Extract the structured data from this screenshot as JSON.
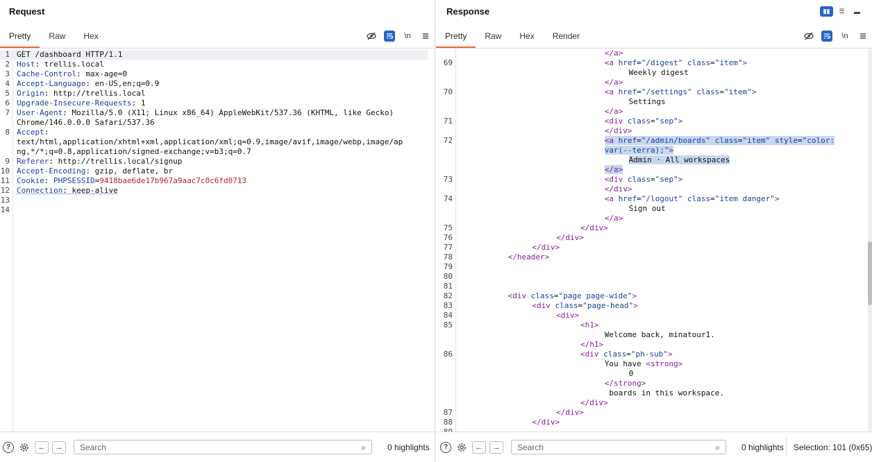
{
  "request": {
    "title": "Request",
    "tabs": [
      "Pretty",
      "Raw",
      "Hex"
    ],
    "lines": [
      {
        "n": "1",
        "parts": [
          [
            "v",
            "GET /dashboard HTTP/1.1"
          ]
        ]
      },
      {
        "n": "2",
        "parts": [
          [
            "k",
            "Host"
          ],
          [
            "v",
            ": trellis.local"
          ]
        ]
      },
      {
        "n": "3",
        "parts": [
          [
            "k",
            "Cache-Control"
          ],
          [
            "v",
            ": max-age=0"
          ]
        ]
      },
      {
        "n": "4",
        "parts": [
          [
            "k",
            "Accept-Language"
          ],
          [
            "v",
            ": en-US,en;q=0.9"
          ]
        ]
      },
      {
        "n": "5",
        "parts": [
          [
            "k",
            "Origin"
          ],
          [
            "v",
            ": http://trellis.local"
          ]
        ]
      },
      {
        "n": "6",
        "parts": [
          [
            "k",
            "Upgrade-Insecure-Requests"
          ],
          [
            "v",
            ": 1"
          ]
        ]
      },
      {
        "n": "7",
        "parts": [
          [
            "k",
            "User-Agent"
          ],
          [
            "v",
            ": Mozilla/5.0 (X11; Linux x86_64) AppleWebKit/537.36 (KHTML, like Gecko)"
          ]
        ]
      },
      {
        "n": "",
        "parts": [
          [
            "v",
            "Chrome/146.0.0.0 Safari/537.36"
          ]
        ]
      },
      {
        "n": "8",
        "parts": [
          [
            "k",
            "Accept"
          ],
          [
            "v",
            ":"
          ]
        ]
      },
      {
        "n": "",
        "parts": [
          [
            "v",
            "text/html,application/xhtml+xml,application/xml;q=0.9,image/avif,image/webp,image/ap"
          ]
        ]
      },
      {
        "n": "",
        "parts": [
          [
            "v",
            "ng,*/*;q=0.8,application/signed-exchange;v=b3;q=0.7"
          ]
        ]
      },
      {
        "n": "9",
        "parts": [
          [
            "k",
            "Referer"
          ],
          [
            "v",
            ": http://trellis.local/signup"
          ]
        ]
      },
      {
        "n": "10",
        "parts": [
          [
            "k",
            "Accept-Encoding"
          ],
          [
            "v",
            ": gzip, deflate, br"
          ]
        ]
      },
      {
        "n": "11",
        "parts": [
          [
            "k",
            "Cookie"
          ],
          [
            "v",
            ": "
          ],
          [
            "k",
            "PHPSESSID"
          ],
          [
            "v",
            "="
          ],
          [
            "cookie",
            "9418bae6de17b967a9aac7c0c6fd0713"
          ]
        ]
      },
      {
        "n": "12",
        "parts": [
          [
            "k",
            "Connection"
          ],
          [
            "v",
            ": keep-alive"
          ]
        ]
      },
      {
        "n": "13",
        "parts": []
      },
      {
        "n": "14",
        "parts": []
      }
    ],
    "search_placeholder": "Search",
    "highlights": "0 highlights"
  },
  "response": {
    "title": "Response",
    "tabs": [
      "Pretty",
      "Raw",
      "Hex",
      "Render"
    ],
    "lines": [
      {
        "n": "",
        "i": 6,
        "parts": [
          [
            "tag",
            "</a>"
          ]
        ]
      },
      {
        "n": "69",
        "i": 6,
        "parts": [
          [
            "tag",
            "<a "
          ],
          [
            "attr",
            "href"
          ],
          [
            "v",
            "="
          ],
          [
            "str",
            "\"/digest\""
          ],
          [
            "v",
            " "
          ],
          [
            "attr",
            "class"
          ],
          [
            "v",
            "="
          ],
          [
            "str",
            "\"item\""
          ],
          [
            "tag",
            ">"
          ]
        ]
      },
      {
        "n": "",
        "i": 7,
        "parts": [
          [
            "v",
            "Weekly digest"
          ]
        ]
      },
      {
        "n": "",
        "i": 6,
        "parts": [
          [
            "tag",
            "</a>"
          ]
        ]
      },
      {
        "n": "70",
        "i": 6,
        "parts": [
          [
            "tag",
            "<a "
          ],
          [
            "attr",
            "href"
          ],
          [
            "v",
            "="
          ],
          [
            "str",
            "\"/settings\""
          ],
          [
            "v",
            " "
          ],
          [
            "attr",
            "class"
          ],
          [
            "v",
            "="
          ],
          [
            "str",
            "\"item\""
          ],
          [
            "tag",
            ">"
          ]
        ]
      },
      {
        "n": "",
        "i": 7,
        "parts": [
          [
            "v",
            "Settings"
          ]
        ]
      },
      {
        "n": "",
        "i": 6,
        "parts": [
          [
            "tag",
            "</a>"
          ]
        ]
      },
      {
        "n": "71",
        "i": 6,
        "parts": [
          [
            "tag",
            "<div "
          ],
          [
            "attr",
            "class"
          ],
          [
            "v",
            "="
          ],
          [
            "str",
            "\"sep\""
          ],
          [
            "tag",
            ">"
          ]
        ]
      },
      {
        "n": "",
        "i": 6,
        "parts": [
          [
            "tag",
            "</div>"
          ]
        ]
      },
      {
        "n": "72",
        "i": 6,
        "sel": true,
        "parts": [
          [
            "tag",
            "<a "
          ],
          [
            "attr",
            "href"
          ],
          [
            "v",
            "="
          ],
          [
            "str",
            "\"/admin/boards\""
          ],
          [
            "v",
            " "
          ],
          [
            "attr",
            "class"
          ],
          [
            "v",
            "="
          ],
          [
            "str",
            "\"item\""
          ],
          [
            "v",
            " "
          ],
          [
            "attr",
            "style"
          ],
          [
            "v",
            "="
          ],
          [
            "str",
            "\"color:"
          ]
        ]
      },
      {
        "n": "",
        "i": 6,
        "sel": true,
        "parts": [
          [
            "str",
            "var(--terra);\""
          ],
          [
            "tag",
            ">"
          ]
        ]
      },
      {
        "n": "",
        "i": 7,
        "sel": true,
        "parts": [
          [
            "v",
            "Admin · All workspaces"
          ]
        ]
      },
      {
        "n": "",
        "i": 6,
        "sel": true,
        "parts": [
          [
            "tag",
            "</a>"
          ]
        ]
      },
      {
        "n": "73",
        "i": 6,
        "parts": [
          [
            "tag",
            "<div "
          ],
          [
            "attr",
            "class"
          ],
          [
            "v",
            "="
          ],
          [
            "str",
            "\"sep\""
          ],
          [
            "tag",
            ">"
          ]
        ]
      },
      {
        "n": "",
        "i": 6,
        "parts": [
          [
            "tag",
            "</div>"
          ]
        ]
      },
      {
        "n": "74",
        "i": 6,
        "parts": [
          [
            "tag",
            "<a "
          ],
          [
            "attr",
            "href"
          ],
          [
            "v",
            "="
          ],
          [
            "str",
            "\"/logout\""
          ],
          [
            "v",
            " "
          ],
          [
            "attr",
            "class"
          ],
          [
            "v",
            "="
          ],
          [
            "str",
            "\"item danger\""
          ],
          [
            "tag",
            ">"
          ]
        ]
      },
      {
        "n": "",
        "i": 7,
        "parts": [
          [
            "v",
            "Sign out"
          ]
        ]
      },
      {
        "n": "",
        "i": 6,
        "parts": [
          [
            "tag",
            "</a>"
          ]
        ]
      },
      {
        "n": "75",
        "i": 5,
        "parts": [
          [
            "tag",
            "</div>"
          ]
        ]
      },
      {
        "n": "76",
        "i": 4,
        "parts": [
          [
            "tag",
            "</div>"
          ]
        ]
      },
      {
        "n": "77",
        "i": 3,
        "parts": [
          [
            "tag",
            "</div>"
          ]
        ]
      },
      {
        "n": "78",
        "i": 2,
        "parts": [
          [
            "tag",
            "</header>"
          ]
        ]
      },
      {
        "n": "79",
        "i": 0,
        "parts": []
      },
      {
        "n": "80",
        "i": 0,
        "parts": []
      },
      {
        "n": "81",
        "i": 0,
        "parts": []
      },
      {
        "n": "82",
        "i": 2,
        "parts": [
          [
            "tag",
            "<div "
          ],
          [
            "attr",
            "class"
          ],
          [
            "v",
            "="
          ],
          [
            "str",
            "\"page page-wide\""
          ],
          [
            "tag",
            ">"
          ]
        ]
      },
      {
        "n": "83",
        "i": 3,
        "parts": [
          [
            "tag",
            "<div "
          ],
          [
            "attr",
            "class"
          ],
          [
            "v",
            "="
          ],
          [
            "str",
            "\"page-head\""
          ],
          [
            "tag",
            ">"
          ]
        ]
      },
      {
        "n": "84",
        "i": 4,
        "parts": [
          [
            "tag",
            "<div>"
          ]
        ]
      },
      {
        "n": "85",
        "i": 5,
        "parts": [
          [
            "tag",
            "<h1>"
          ]
        ]
      },
      {
        "n": "",
        "i": 6,
        "parts": [
          [
            "v",
            "Welcome back, minatour1."
          ]
        ]
      },
      {
        "n": "",
        "i": 5,
        "parts": [
          [
            "tag",
            "</h1>"
          ]
        ]
      },
      {
        "n": "86",
        "i": 5,
        "parts": [
          [
            "tag",
            "<div "
          ],
          [
            "attr",
            "class"
          ],
          [
            "v",
            "="
          ],
          [
            "str",
            "\"ph-sub\""
          ],
          [
            "tag",
            ">"
          ]
        ]
      },
      {
        "n": "",
        "i": 6,
        "parts": [
          [
            "v",
            "You have "
          ],
          [
            "tag",
            "<strong>"
          ]
        ]
      },
      {
        "n": "",
        "i": 7,
        "parts": [
          [
            "v",
            "0"
          ]
        ]
      },
      {
        "n": "",
        "i": 6,
        "parts": [
          [
            "tag",
            "</strong>"
          ]
        ]
      },
      {
        "n": "",
        "i": 6,
        "parts": [
          [
            "v",
            " boards in this workspace."
          ]
        ]
      },
      {
        "n": "",
        "i": 5,
        "parts": [
          [
            "tag",
            "</div>"
          ]
        ]
      },
      {
        "n": "87",
        "i": 4,
        "parts": [
          [
            "tag",
            "</div>"
          ]
        ]
      },
      {
        "n": "88",
        "i": 3,
        "parts": [
          [
            "tag",
            "</div>"
          ]
        ]
      },
      {
        "n": "89",
        "i": 0,
        "parts": []
      }
    ],
    "search_placeholder": "Search",
    "highlights": "0 highlights",
    "selection": "Selection: 101 (0x65)"
  },
  "icons": {
    "hide": "eye-slash-icon",
    "wrap": "wrap-icon",
    "newline": "\\n",
    "menu": "menu-icon"
  },
  "colors": {
    "accent": "#e8683a",
    "selection": "#c7d7f0",
    "toggle": "#2a64c5"
  }
}
